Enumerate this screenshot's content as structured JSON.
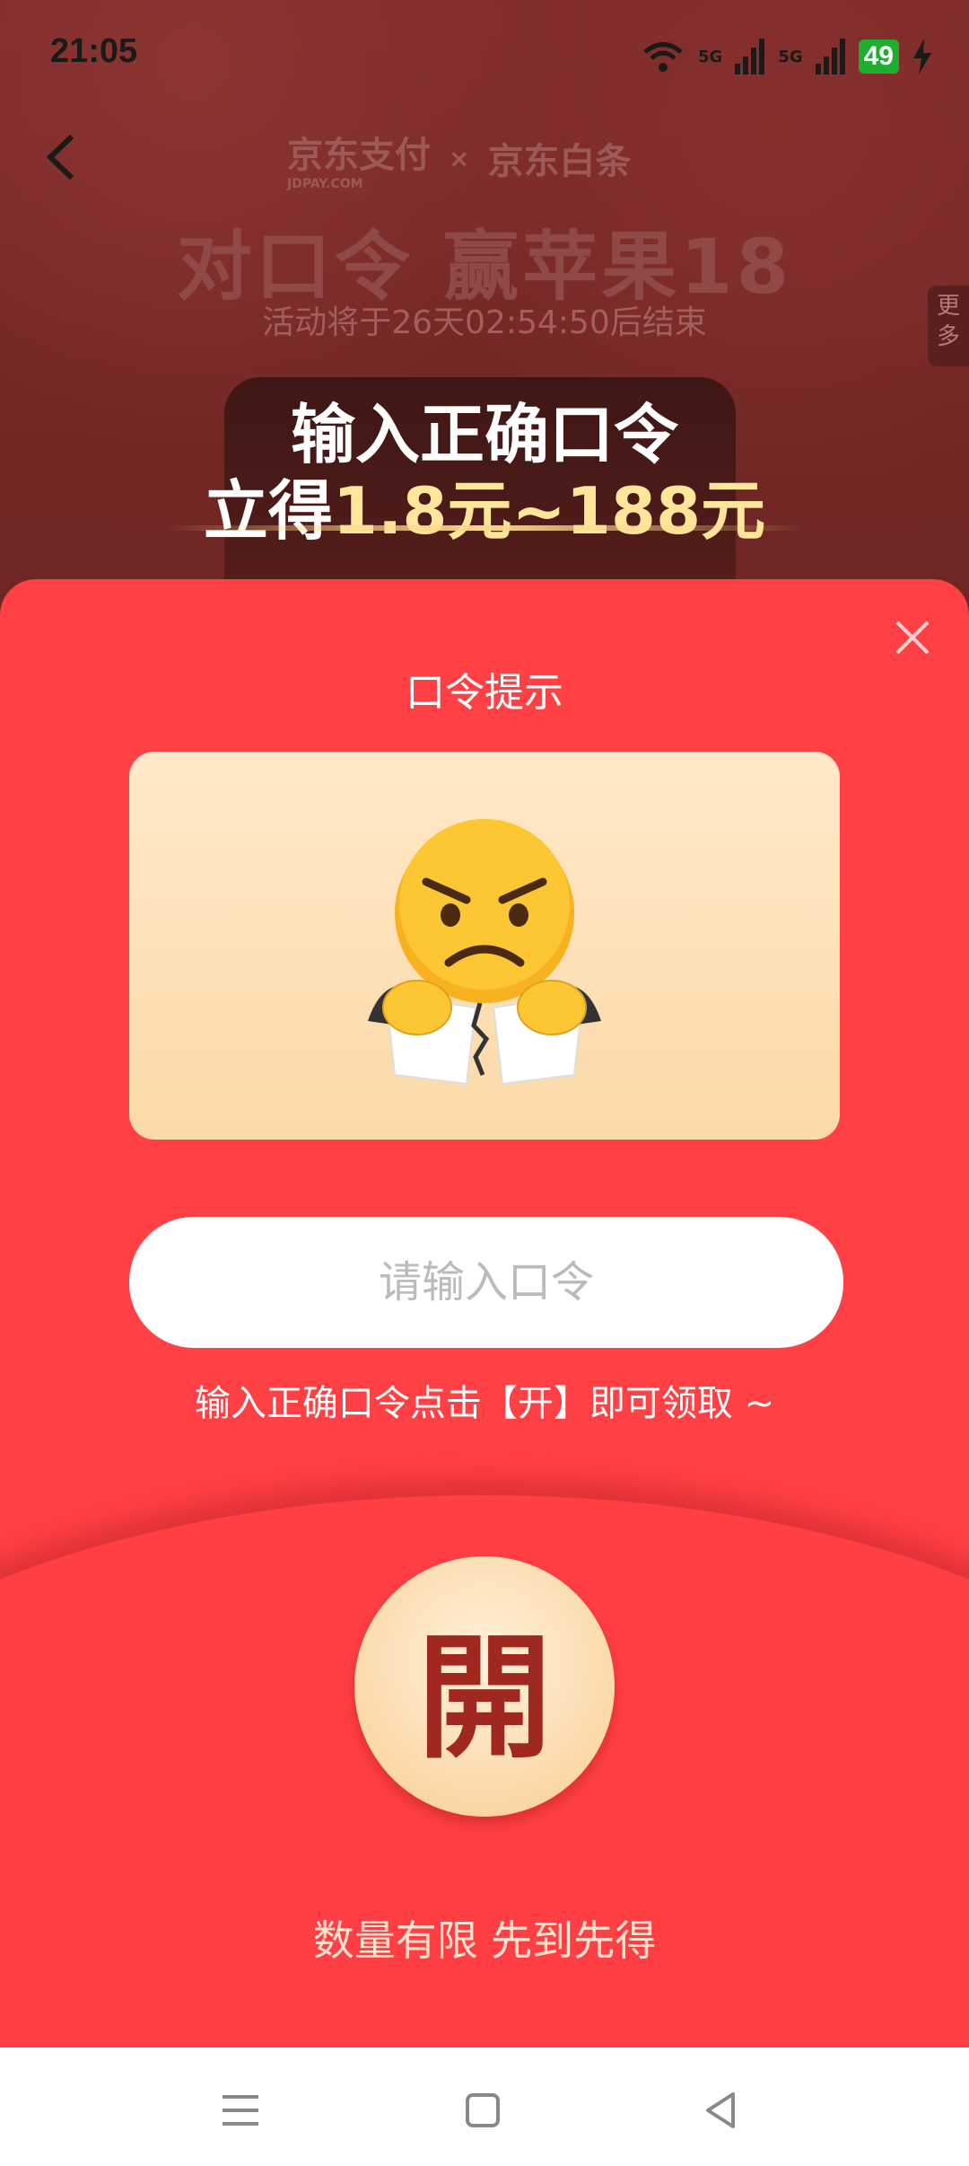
{
  "status_bar": {
    "time": "21:05",
    "network_1": "5G",
    "network_2": "5G",
    "battery": "49"
  },
  "header": {
    "brand_pay": "京东支付",
    "brand_pay_sub": "JDPAY.COM",
    "brand_sep": "×",
    "brand_baitiao": "京东白条"
  },
  "background_page": {
    "title": "对口令 赢苹果18",
    "countdown": "活动将于26天02:54:50后结束",
    "more_tab": "更多",
    "promo_line1": "输入正确口令",
    "promo_line2_prefix": "立得",
    "promo_amount": "1.8元~188元"
  },
  "modal": {
    "title": "口令提示",
    "input_placeholder": "请输入口令",
    "input_value": "",
    "instruction": "输入正确口令点击【开】即可领取 ~",
    "open_button_label": "開",
    "footer_text": "数量有限 先到先得"
  },
  "colors": {
    "modal_red": "#ff4146",
    "card_cream": "#ffe9c8",
    "open_button_text": "#a0281e"
  }
}
